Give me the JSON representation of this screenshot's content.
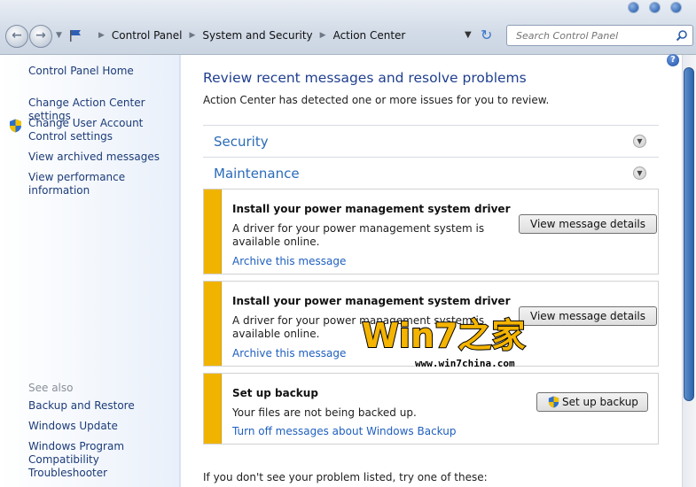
{
  "address_bar": {
    "breadcrumb": [
      "Control Panel",
      "System and Security",
      "Action Center"
    ],
    "search_placeholder": "Search Control Panel"
  },
  "sidebar": {
    "items": [
      {
        "label": "Control Panel Home"
      },
      {
        "label": "Change Action Center settings"
      },
      {
        "label": "Change User Account Control settings"
      },
      {
        "label": "View archived messages"
      },
      {
        "label": "View performance information"
      }
    ],
    "see_also_header": "See also",
    "see_also": [
      {
        "label": "Backup and Restore"
      },
      {
        "label": "Windows Update"
      },
      {
        "label": "Windows Program Compatibility Troubleshooter"
      }
    ]
  },
  "main": {
    "title": "Review recent messages and resolve problems",
    "subtitle": "Action Center has detected one or more issues for you to review.",
    "sections": [
      {
        "label": "Security"
      },
      {
        "label": "Maintenance"
      }
    ],
    "messages": [
      {
        "title": "Install your power management system driver",
        "body": "A driver for your power management system is available online.",
        "link": "Archive this message",
        "button": "View message details"
      },
      {
        "title": "Install your power management system driver",
        "body": "A driver for your power management system is available online.",
        "link": "Archive this message",
        "button": "View message details"
      },
      {
        "title": "Set up backup",
        "body": "Your files are not being backed up.",
        "link": "Turn off messages about Windows Backup",
        "button": "Set up backup"
      }
    ],
    "footer_text": "If you don't see your problem listed, try one of these:"
  },
  "watermark": {
    "logo_text": "Win7之家",
    "url": "www.win7china.com"
  },
  "colors": {
    "accent_bar": "#f0b400",
    "link": "#1f5fbf",
    "title": "#1f3f8f"
  }
}
